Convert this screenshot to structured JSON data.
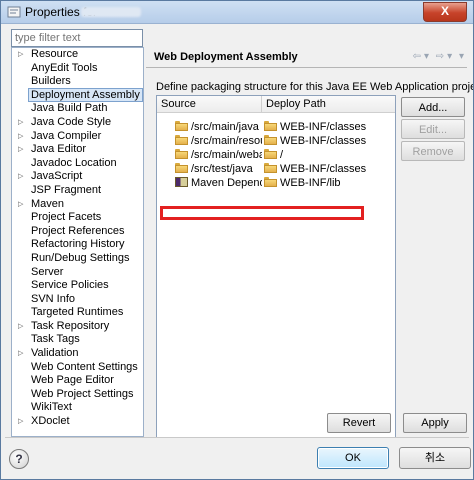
{
  "window": {
    "title": "Properties for",
    "close_label": "X",
    "colors": {
      "title_bar": "#b6cde9",
      "close": "#c7432a",
      "selection": "#d7e6f7",
      "highlight": "#e32020"
    }
  },
  "filter": {
    "placeholder": "type filter text"
  },
  "nav_items": [
    {
      "label": "Resource",
      "expandable": true
    },
    {
      "label": "AnyEdit Tools",
      "expandable": false
    },
    {
      "label": "Builders",
      "expandable": false
    },
    {
      "label": "Deployment Assembly",
      "expandable": false,
      "selected": true
    },
    {
      "label": "Java Build Path",
      "expandable": false
    },
    {
      "label": "Java Code Style",
      "expandable": true
    },
    {
      "label": "Java Compiler",
      "expandable": true
    },
    {
      "label": "Java Editor",
      "expandable": true
    },
    {
      "label": "Javadoc Location",
      "expandable": false
    },
    {
      "label": "JavaScript",
      "expandable": true
    },
    {
      "label": "JSP Fragment",
      "expandable": false
    },
    {
      "label": "Maven",
      "expandable": true
    },
    {
      "label": "Project Facets",
      "expandable": false
    },
    {
      "label": "Project References",
      "expandable": false
    },
    {
      "label": "Refactoring History",
      "expandable": false
    },
    {
      "label": "Run/Debug Settings",
      "expandable": false
    },
    {
      "label": "Server",
      "expandable": false
    },
    {
      "label": "Service Policies",
      "expandable": false
    },
    {
      "label": "SVN Info",
      "expandable": false
    },
    {
      "label": "Targeted Runtimes",
      "expandable": false
    },
    {
      "label": "Task Repository",
      "expandable": true
    },
    {
      "label": "Task Tags",
      "expandable": false
    },
    {
      "label": "Validation",
      "expandable": true
    },
    {
      "label": "Web Content Settings",
      "expandable": false
    },
    {
      "label": "Web Page Editor",
      "expandable": false
    },
    {
      "label": "Web Project Settings",
      "expandable": false
    },
    {
      "label": "WikiText",
      "expandable": false
    },
    {
      "label": "XDoclet",
      "expandable": true
    }
  ],
  "page": {
    "title": "Web Deployment Assembly",
    "description": "Define packaging structure for this Java EE Web Application project."
  },
  "table": {
    "headers": [
      "Source",
      "Deploy Path"
    ],
    "rows": [
      {
        "source": "/src/main/java",
        "deploy": "WEB-INF/classes",
        "icon": "folder-icon"
      },
      {
        "source": "/src/main/resources",
        "deploy": "WEB-INF/classes",
        "icon": "folder-icon"
      },
      {
        "source": "/src/main/webapp",
        "deploy": "/",
        "icon": "folder-icon"
      },
      {
        "source": "/src/test/java",
        "deploy": "WEB-INF/classes",
        "icon": "folder-icon"
      },
      {
        "source": "Maven Dependencies",
        "deploy": "WEB-INF/lib",
        "icon": "library-icon"
      }
    ]
  },
  "buttons": {
    "add": "Add...",
    "edit": "Edit...",
    "remove": "Remove",
    "revert": "Revert",
    "apply": "Apply",
    "ok": "OK",
    "cancel": "취소"
  },
  "help_label": "?"
}
